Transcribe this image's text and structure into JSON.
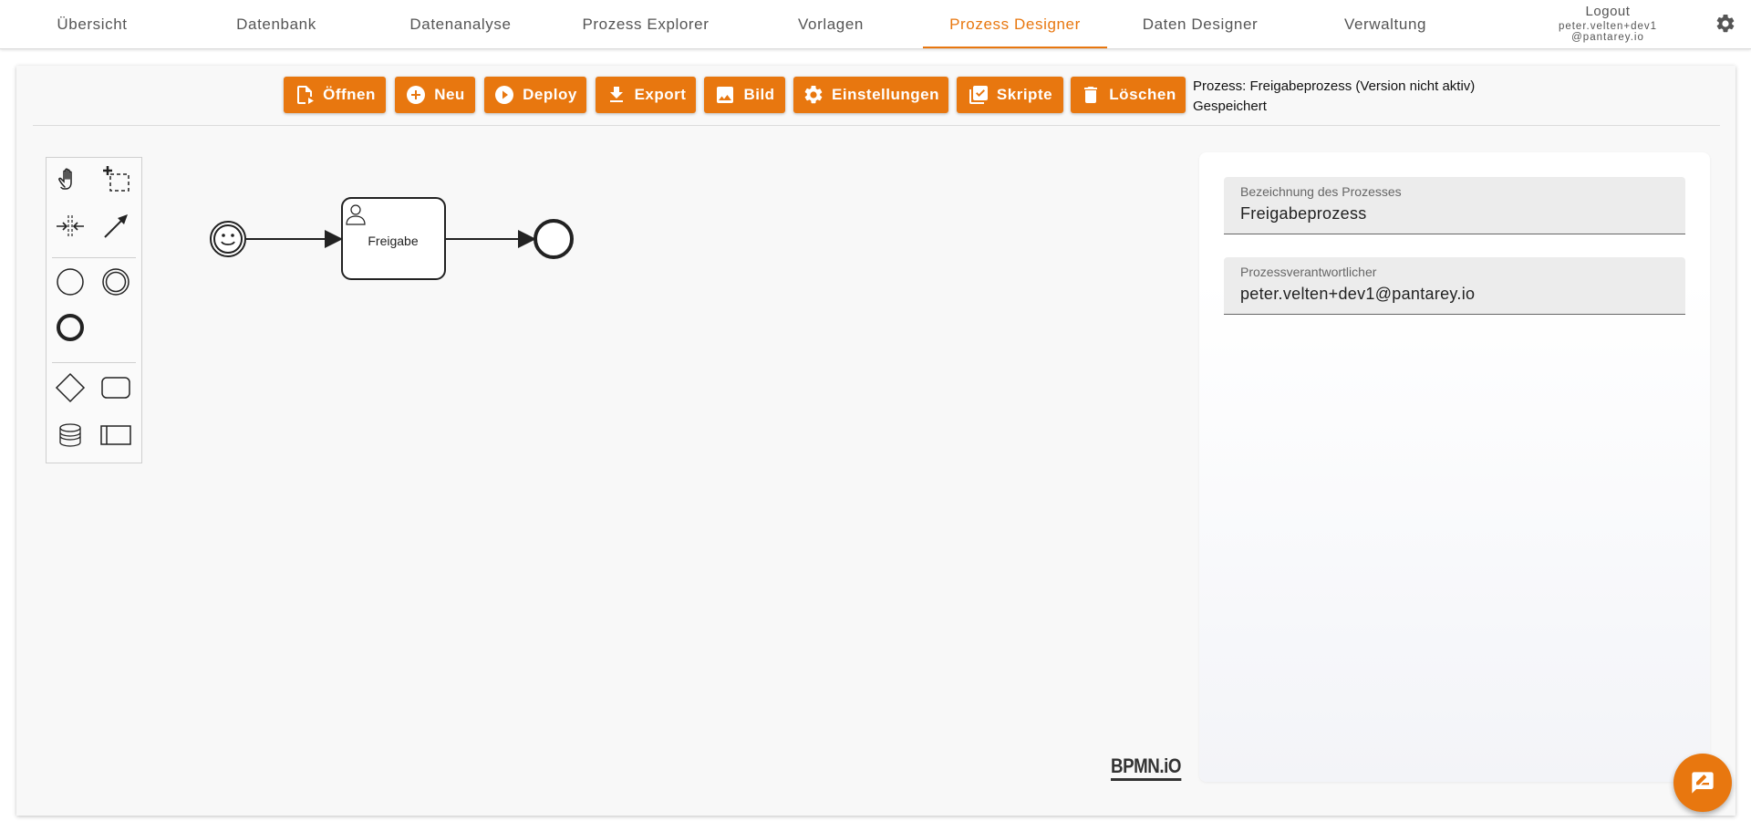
{
  "nav": {
    "tabs": [
      {
        "label": "Übersicht"
      },
      {
        "label": "Datenbank"
      },
      {
        "label": "Datenanalyse"
      },
      {
        "label": "Prozess Explorer"
      },
      {
        "label": "Vorlagen"
      },
      {
        "label": "Prozess Designer",
        "active": true
      },
      {
        "label": "Daten Designer"
      },
      {
        "label": "Verwaltung"
      }
    ],
    "logout_label": "Logout",
    "user_email": "peter.velten+dev1@pantarey.io",
    "settings_icon": "gear-icon",
    "accent_color": "#e8770f"
  },
  "toolbar": {
    "buttons": [
      {
        "label": "Öffnen",
        "icon": "file-open-icon"
      },
      {
        "label": "Neu",
        "icon": "plus-circle-icon"
      },
      {
        "label": "Deploy",
        "icon": "play-circle-icon"
      },
      {
        "label": "Export",
        "icon": "download-icon"
      },
      {
        "label": "Bild",
        "icon": "image-icon"
      },
      {
        "label": "Einstellungen",
        "icon": "gear-icon"
      },
      {
        "label": "Skripte",
        "icon": "checklist-icon"
      },
      {
        "label": "Löschen",
        "icon": "trash-icon"
      }
    ],
    "process_line": "Prozess: Freigabeprozess (Version nicht aktiv)",
    "save_status": "Gespeichert"
  },
  "palette": {
    "tools": [
      "hand-tool-icon",
      "lasso-tool-icon",
      "space-tool-icon",
      "connect-tool-icon"
    ],
    "events": [
      "start-event-icon",
      "intermediate-event-icon",
      "end-event-icon"
    ],
    "elements": [
      "gateway-icon",
      "task-icon",
      "data-store-icon",
      "pool-icon"
    ]
  },
  "diagram": {
    "task_label": "Freigabe",
    "start_event": "start-event-smiley",
    "end_event": "end-event"
  },
  "watermark": "BPMN.iO",
  "properties": {
    "name_label": "Bezeichnung des Prozesses",
    "name_value": "Freigabeprozess",
    "owner_label": "Prozessverantwortlicher",
    "owner_value": "peter.velten+dev1@pantarey.io"
  },
  "fab": {
    "icon": "chat-feedback-icon"
  }
}
